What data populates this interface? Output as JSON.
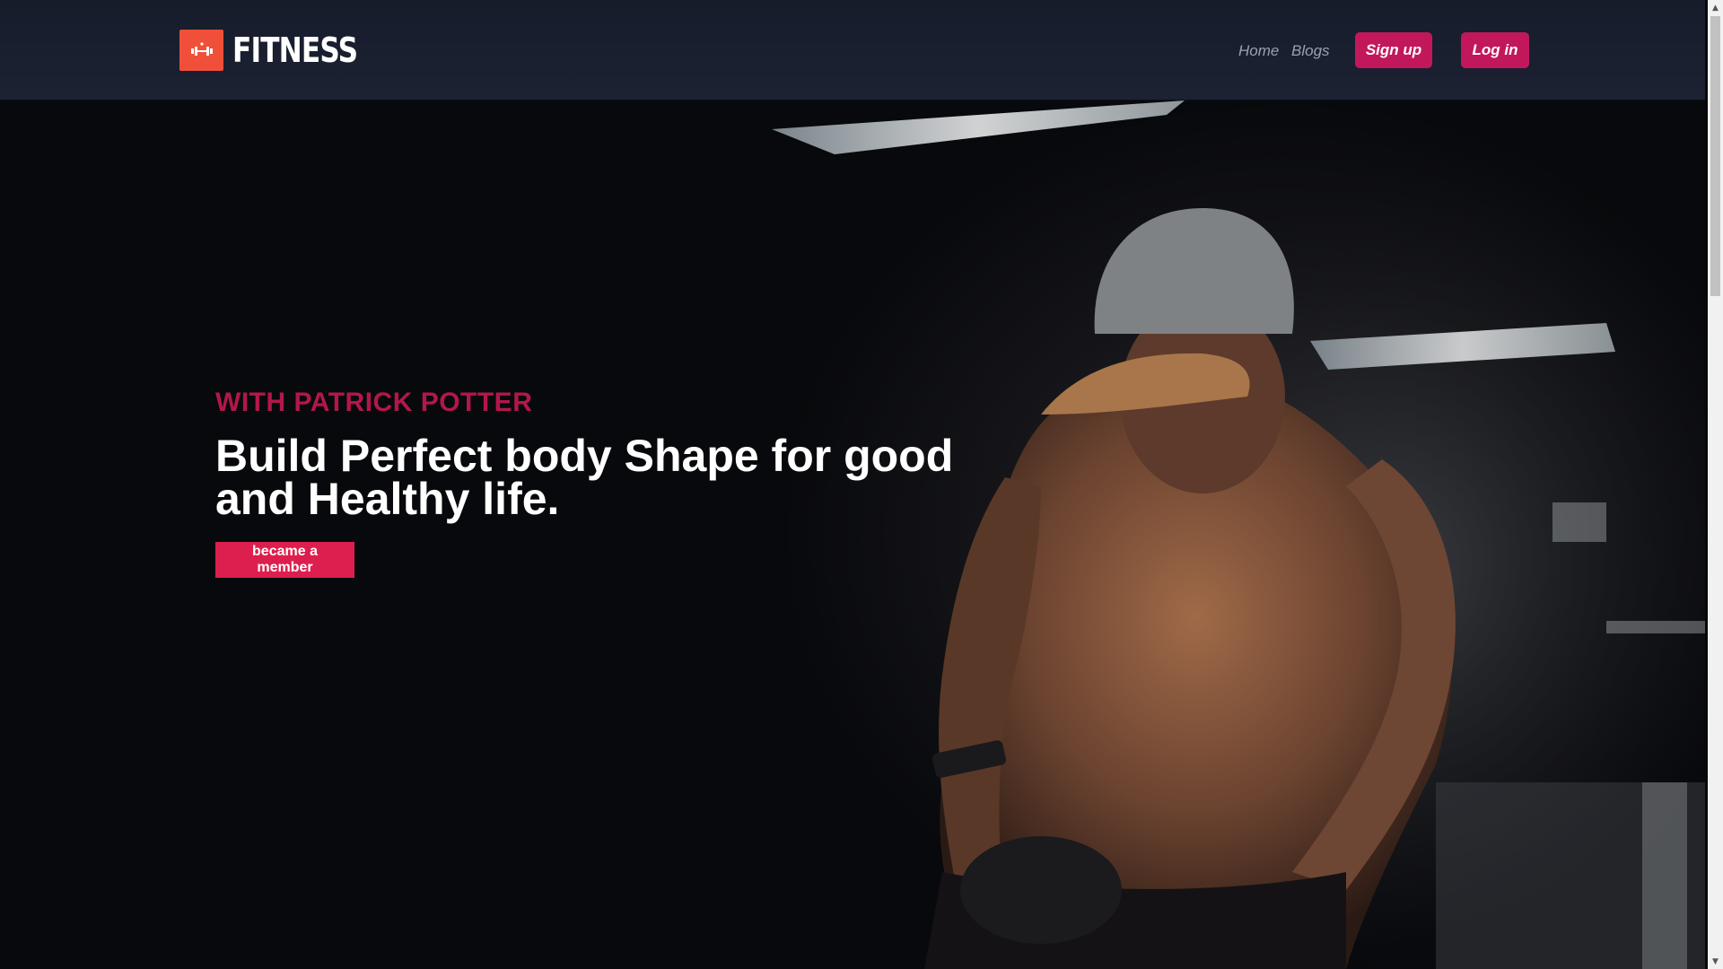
{
  "brand": {
    "name": "FITNESS",
    "icon": "dumbbell-icon",
    "accent": "#f0503a"
  },
  "nav": {
    "links": [
      {
        "label": "Home"
      },
      {
        "label": "Blogs"
      }
    ],
    "signup_label": "Sign up",
    "login_label": "Log in",
    "button_color": "#c2185b"
  },
  "hero": {
    "subtitle": "WITH PATRICK POTTER",
    "title": "Build Perfect body Shape for good and Healthy life.",
    "cta_label": "became a member",
    "subtitle_color": "#b3174a",
    "cta_color": "#dc1f4e"
  }
}
